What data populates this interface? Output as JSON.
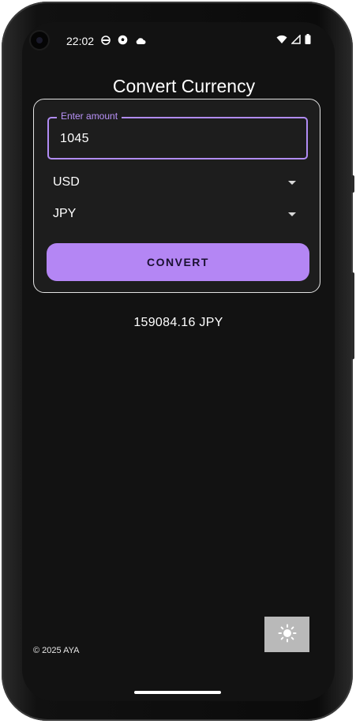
{
  "status_bar": {
    "time": "22:02",
    "left_icons": [
      "android-face-icon",
      "soccer-ball-icon",
      "cloud-icon"
    ],
    "right_icons": [
      "wifi-icon",
      "cellular-signal-icon",
      "battery-icon"
    ]
  },
  "title": "Convert Currency",
  "form": {
    "amount_label": "Enter amount",
    "amount_value": "1045",
    "from_currency": "USD",
    "to_currency": "JPY",
    "convert_label": "CONVERT"
  },
  "result": "159084.16 JPY",
  "footer": "© 2025 AYA",
  "theme_toggle_icon": "sun-icon",
  "colors": {
    "background": "#121212",
    "card": "#1d1d1d",
    "accent": "#b486f4",
    "accent_label": "#b992f8",
    "toggle_bg": "#b9b9b9"
  }
}
